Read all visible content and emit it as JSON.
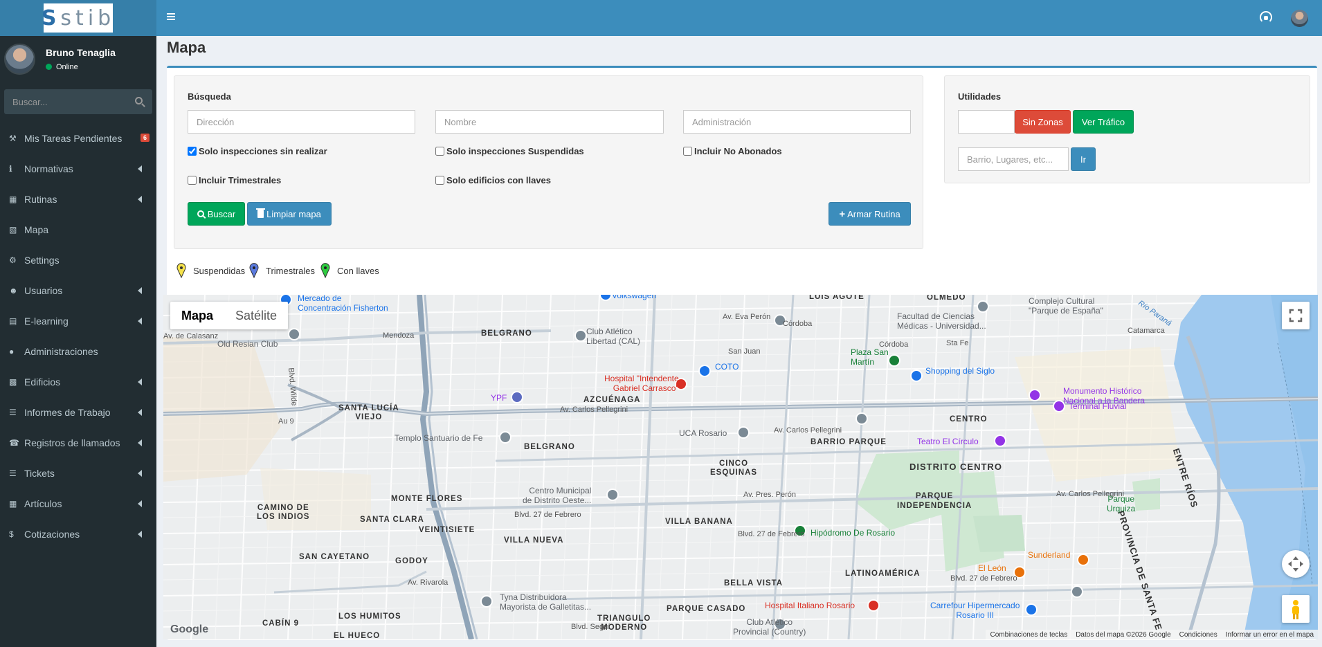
{
  "app": {
    "logo_text": "stib"
  },
  "user": {
    "name": "Bruno Tenaglia",
    "status": "Online"
  },
  "sidebar": {
    "search_placeholder": "Buscar...",
    "items": [
      {
        "label": "Mis Tareas Pendientes",
        "icon": "wrench-icon",
        "badge": "6"
      },
      {
        "label": "Normativas",
        "icon": "info-icon"
      },
      {
        "label": "Rutinas",
        "icon": "calendar-icon"
      },
      {
        "label": "Mapa",
        "icon": "map-icon"
      },
      {
        "label": "Settings",
        "icon": "gear-icon"
      },
      {
        "label": "Usuarios",
        "icon": "users-icon"
      },
      {
        "label": "E-learning",
        "icon": "book-icon"
      },
      {
        "label": "Administraciones",
        "icon": "user-icon"
      },
      {
        "label": "Edificios",
        "icon": "building-icon"
      },
      {
        "label": "Informes de Trabajo",
        "icon": "list-icon"
      },
      {
        "label": "Registros de llamados",
        "icon": "phone-icon"
      },
      {
        "label": "Tickets",
        "icon": "list-icon"
      },
      {
        "label": "Artículos",
        "icon": "sitemap-icon"
      },
      {
        "label": "Cotizaciones",
        "icon": "dollar-icon"
      }
    ]
  },
  "page": {
    "title": "Mapa"
  },
  "busqueda": {
    "title": "Búsqueda",
    "direccion_placeholder": "Dirección",
    "nombre_placeholder": "Nombre",
    "administracion_placeholder": "Administración",
    "checks": {
      "sin_realizar": "Solo inspecciones sin realizar",
      "suspendidas": "Solo inspecciones Suspendidas",
      "no_abonados": "Incluir No Abonados",
      "trimestrales": "Incluir Trimestrales",
      "llaves": "Solo edificios con llaves"
    },
    "buscar": "Buscar",
    "limpiar": "Limpiar mapa",
    "armar": "Armar Rutina"
  },
  "utilidades": {
    "title": "Utilidades",
    "sin_zonas": "Sin Zonas",
    "ver_trafico": "Ver Tráfico",
    "barrio_placeholder": "Barrio, Lugares, etc...",
    "ir": "Ir"
  },
  "legend": {
    "suspendidas": "Suspendidas",
    "trimestrales": "Trimestrales",
    "llaves": "Con llaves",
    "colors": {
      "suspendidas": "#f5e24b",
      "trimestrales": "#5b7be0",
      "llaves": "#2ecc40"
    }
  },
  "map": {
    "type_map": "Mapa",
    "type_satellite": "Satélite",
    "google": "Google",
    "attr": {
      "keys": "Combinaciones de teclas",
      "data": "Datos del mapa ©2026 Google",
      "terms": "Condiciones",
      "report": "Informar un error en el mapa"
    },
    "labels": {
      "mercado": "Mercado de\nConcentración Fisherton",
      "volkswagen": "Volkswagen",
      "luis_agote": "LUIS AGOTE",
      "olmedo": "OLMEDO",
      "complejo": "Complejo Cultural\n\"Parque de España\"",
      "facultad": "Facultad de Ciencias\nMédicas - Universidad...",
      "old_resian": "Old Resian Club",
      "belgrano1": "BELGRANO",
      "club_cal": "Club Atlético\nLibertad (CAL)",
      "plaza_san_martin": "Plaza San\nMartín",
      "shopping": "Shopping del Siglo",
      "coto": "COTO",
      "hospital_carrasco": "Hospital \"Intendente\nGabriel Carrasco\"",
      "monumento": "Monumento Histórico\nNacional a la Bandera",
      "terminal": "Terminal Fluvial",
      "ypf": "YPF",
      "azcuenaga": "AZCUÉNAGA",
      "santa_lucia": "SANTA LUCÍA\nVIEJO",
      "centro": "CENTRO",
      "uca": "UCA Rosario",
      "barrio_parque": "BARRIO PARQUE",
      "teatro": "Teatro El Círculo",
      "templo": "Templo Santuario de Fe",
      "belgrano2": "BELGRANO",
      "cinco_esquinas": "CINCO\nESQUINAS",
      "distrito_centro": "DISTRITO CENTRO",
      "provincia": "PROVINCIA DE SANTA FE",
      "entre_rios": "ENTRE RÍOS",
      "centro_municipal": "Centro Municipal\nde Distrito Oeste...",
      "monte_flores": "MONTE FLORES",
      "parque_indep": "PARQUE\nINDEPENDENCIA",
      "parque_urquiza": "Parque\nUrquiza",
      "camino_indios": "CAMINO DE\nLOS INDIOS",
      "santa_clara": "SANTA CLARA",
      "veintisiete": "VEINTISIETE",
      "villa_banana": "VILLA BANANA",
      "hipodromo": "Hipódromo De Rosario",
      "villa_nueva": "VILLA NUEVA",
      "sunderland": "Sunderland",
      "san_cayetano": "SAN CAYETANO",
      "godoy": "GODOY",
      "el_leon": "El León",
      "latinoamerica": "LATINOAMÉRICA",
      "bella_vista": "BELLA VISTA",
      "tyna": "Tyna Distribuidora\nMayorista de Galletitas...",
      "hospital_italiano": "Hospital Italiano Rosario",
      "parque_casado": "PARQUE CASADO",
      "carrefour": "Carrefour Hipermercado\nRosario III",
      "los_humitos": "LOS HUMITOS",
      "triangulo": "TRIANGULO\nMODERNO",
      "club_provincial": "Club Atlético\nProvincial (Country)",
      "cabin9": "CABÍN 9",
      "el_hueco": "EL HUECO",
      "road_mendoza": "Mendoza",
      "road_pellegrini": "Av. Carlos Pellegrini",
      "road_pellegrini2": "Av. Carlos Pellegrini",
      "road_pellegrini3": "Av. Carlos Pellegrini",
      "road_27feb": "Blvd. 27 de Febrero",
      "road_27feb2": "Blvd. 27 de Febrero",
      "road_27feb3": "Blvd. 27 de Febrero",
      "road_pres_peron": "Av. Pres. Perón",
      "road_rivarola": "Av. Rivarola",
      "road_eva_peron": "Av. Eva Perón",
      "road_cordoba": "Córdoba",
      "road_cordoba2": "Córdoba",
      "road_santafe": "Sta Fe",
      "road_sanjuan": "San Juan",
      "road_calasanz": "Av. de Calasanz",
      "road_catamarca": "Catamarca",
      "road_au9": "Au 9",
      "road_segui": "Blvd. Seguí",
      "road_wilde": "Blvd. Wilde",
      "water_parana": "Río Paraná"
    }
  }
}
